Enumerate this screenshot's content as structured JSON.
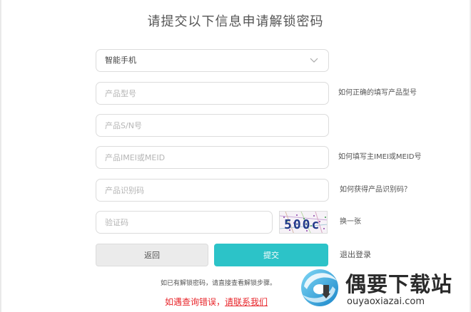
{
  "page": {
    "title": "请提交以下信息申请解锁密码"
  },
  "form": {
    "device_type": {
      "selected": "智能手机"
    },
    "model": {
      "placeholder": "产品型号",
      "hint": "如何正确的填写产品型号"
    },
    "serial": {
      "placeholder": "产品S/N号"
    },
    "imei": {
      "placeholder": "产品IMEI或MEID",
      "hint": "如何填写主IMEI或MEID号"
    },
    "product_id": {
      "placeholder": "产品识别码",
      "hint": "如何获得产品识别码？"
    },
    "captcha": {
      "placeholder": "验证码",
      "image_text": "500c",
      "refresh_label": "换一张"
    },
    "back_label": "返回",
    "submit_label": "提交",
    "logout_label": "退出登录"
  },
  "footer": {
    "note": "如已有解锁密码，请直接查看解锁步骤。",
    "error_prefix": "如遇查询错误，",
    "contact_link": "请联系我们"
  },
  "watermark": {
    "site_name": "偶要下载站",
    "domain": "ouyaoxiazai.com"
  },
  "colors": {
    "accent": "#2cc3c8",
    "error": "#e8262b",
    "border": "#dcdcdc"
  }
}
